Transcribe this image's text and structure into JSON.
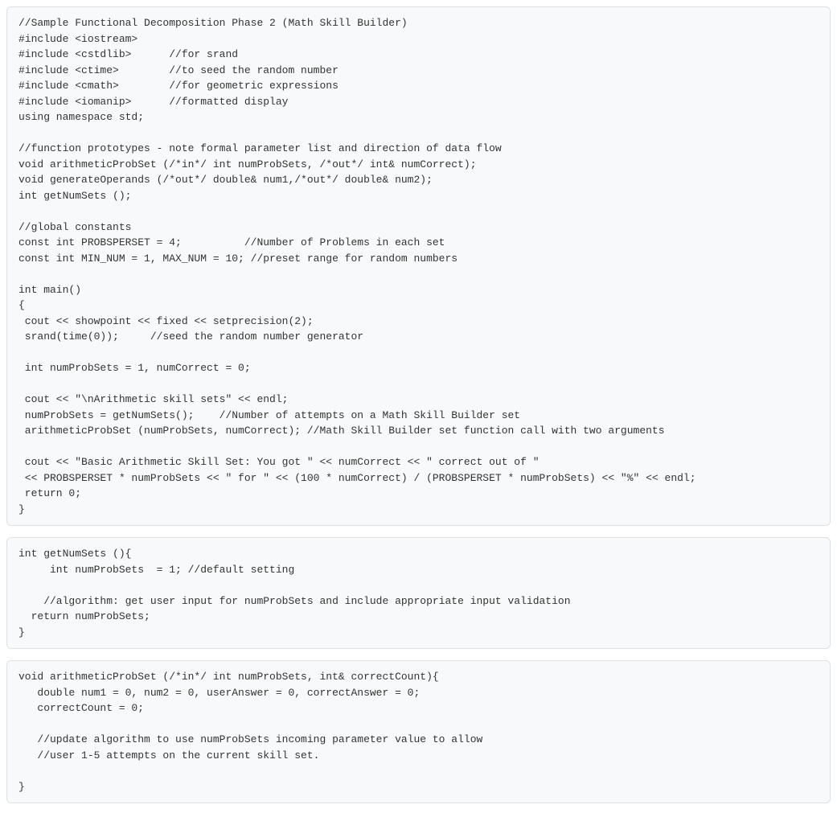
{
  "blocks": [
    {
      "lines": [
        "//Sample Functional Decomposition Phase 2 (Math Skill Builder)",
        "#include <iostream>",
        "#include <cstdlib>      //for srand",
        "#include <ctime>        //to seed the random number",
        "#include <cmath>        //for geometric expressions",
        "#include <iomanip>      //formatted display",
        "using namespace std;",
        "",
        "//function prototypes - note formal parameter list and direction of data flow",
        "void arithmeticProbSet (/*in*/ int numProbSets, /*out*/ int& numCorrect);",
        "void generateOperands (/*out*/ double& num1,/*out*/ double& num2);",
        "int getNumSets ();",
        "",
        "//global constants",
        "const int PROBSPERSET = 4;          //Number of Problems in each set",
        "const int MIN_NUM = 1, MAX_NUM = 10; //preset range for random numbers",
        "",
        "int main()",
        "{",
        " cout << showpoint << fixed << setprecision(2);",
        " srand(time(0));     //seed the random number generator",
        "",
        " int numProbSets = 1, numCorrect = 0;",
        "",
        " cout << \"\\nArithmetic skill sets\" << endl;",
        " numProbSets = getNumSets();    //Number of attempts on a Math Skill Builder set",
        " arithmeticProbSet (numProbSets, numCorrect); //Math Skill Builder set function call with two arguments",
        "",
        " cout << \"Basic Arithmetic Skill Set: You got \" << numCorrect << \" correct out of \"",
        " << PROBSPERSET * numProbSets << \" for \" << (100 * numCorrect) / (PROBSPERSET * numProbSets) << \"%\" << endl;",
        " return 0;",
        "}"
      ]
    },
    {
      "lines": [
        "int getNumSets (){",
        "     int numProbSets  = 1; //default setting",
        "",
        "    //algorithm: get user input for numProbSets and include appropriate input validation",
        "  return numProbSets;",
        "}"
      ]
    },
    {
      "lines": [
        "void arithmeticProbSet (/*in*/ int numProbSets, int& correctCount){",
        "   double num1 = 0, num2 = 0, userAnswer = 0, correctAnswer = 0;",
        "   correctCount = 0;",
        "",
        "   //update algorithm to use numProbSets incoming parameter value to allow",
        "   //user 1-5 attempts on the current skill set.",
        "",
        "}"
      ]
    }
  ]
}
